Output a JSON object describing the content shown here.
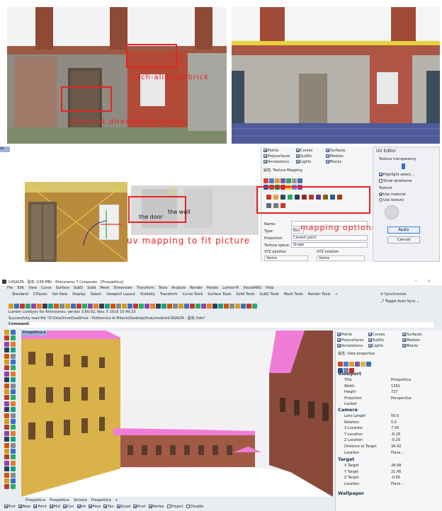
{
  "annotations_top": {
    "arch_label": "arch-aligned brick",
    "wood_label": "different direction of wood"
  },
  "annotations_mid": {
    "door_label": "the door",
    "wall_label": "the wall",
    "uv_label": "uv mapping to fit picture",
    "mapping_label": "mapping options"
  },
  "mid_panel": {
    "tab_label": "ra",
    "filters": [
      {
        "label": "Points",
        "checked": true
      },
      {
        "label": "Curves",
        "checked": true
      },
      {
        "label": "Surfaces",
        "checked": true
      },
      {
        "label": "Polysurfaces",
        "checked": true
      },
      {
        "label": "SubDs",
        "checked": true
      },
      {
        "label": "Meshes",
        "checked": true
      },
      {
        "label": "Annotations",
        "checked": true
      },
      {
        "label": "Lights",
        "checked": true
      },
      {
        "label": "Blocks",
        "checked": true
      }
    ],
    "section_title": "属性: Texture Mapping",
    "name_label": "Name:",
    "type_label": "Type:",
    "type_value": "Box",
    "projection_label": "Projection:",
    "projection_value": "Closest point",
    "texture_space_label": "Texture space:",
    "texture_space_value": "Single",
    "xyz_position_label": "XYZ position",
    "xyz_rotation_label": "XYZ rotation",
    "varies": "Varies"
  },
  "uv_editor": {
    "title": "UV Editor",
    "transparency_label": "Texture transparency",
    "highlight_label": "Highlight select...",
    "wireframe_label": "Show wireframe",
    "texture_label": "Texture",
    "use_material": "Use material",
    "use_texture": "Use texture",
    "apply": "Apply",
    "cancel": "Cancel"
  },
  "rhino": {
    "title": "CASALTA - 副本 (158 MB) - Rhinoceros 7 Corporate - [Prospettica]",
    "menu": [
      "File",
      "Edit",
      "View",
      "Curve",
      "Surface",
      "SubD",
      "Solid",
      "Mesh",
      "Dimension",
      "Transform",
      "Tools",
      "Analyze",
      "Render",
      "Panels",
      "Lumion®",
      "VisualARQ",
      "Help"
    ],
    "tabs": [
      "Standard",
      "CPlanes",
      "Set View",
      "Display",
      "Select",
      "Viewport Layout",
      "Visibility",
      "Transform",
      "Curve Tools",
      "Surface Tools",
      "Solid Tools",
      "SubD Tools",
      "Mesh Tools",
      "Render Tools"
    ],
    "tabs_more": "»",
    "sync_label": "Synchronize",
    "toggle_label": "Toggle Auto Sync",
    "cmd_history": [
      "Lumion LiveSync for Rhinoceros, version 3.60.62, Nov. 5 2019 15:49:23",
      "Successfully read file \"D:\\OneDrive\\OneDrive - Politecnico di Milano\\Desktop\\finalymodels\\CASALTA - 副本.3dm\""
    ],
    "command_label": "Command:",
    "viewport_label": "Prospettica",
    "bottom_tabs": [
      "Prospettica",
      "Prospettica",
      "Sinistra",
      "Prospettica"
    ],
    "status_snaps": [
      "End",
      "Near",
      "Point",
      "Mid",
      "Cen",
      "Int",
      "Perp",
      "Tan",
      "Quad",
      "Knot",
      "Vertex",
      "Project",
      "Disable"
    ],
    "filters": [
      {
        "label": "Points",
        "checked": true
      },
      {
        "label": "Curves",
        "checked": true
      },
      {
        "label": "Surfaces",
        "checked": true
      },
      {
        "label": "Polysurfaces",
        "checked": true
      },
      {
        "label": "SubDs",
        "checked": true
      },
      {
        "label": "Meshes",
        "checked": true
      },
      {
        "label": "Annotations",
        "checked": true
      },
      {
        "label": "Lights",
        "checked": true
      },
      {
        "label": "Blocks",
        "checked": true
      }
    ],
    "view_props_title": "属性: View properties",
    "viewport_section": "Viewport",
    "viewport_props": [
      {
        "k": "Title",
        "v": "Prospettica"
      },
      {
        "k": "Width",
        "v": "1352"
      },
      {
        "k": "Height",
        "v": "727"
      },
      {
        "k": "Projection",
        "v": "Perspective"
      },
      {
        "k": "Locked",
        "v": ""
      }
    ],
    "camera_section": "Camera",
    "camera_props": [
      {
        "k": "Lens Length",
        "v": "50.0"
      },
      {
        "k": "Rotation",
        "v": "0.0"
      },
      {
        "k": "X Location",
        "v": "7.56"
      },
      {
        "k": "Y Location",
        "v": "-6.18"
      },
      {
        "k": "Z Location",
        "v": "-0.29"
      },
      {
        "k": "Distance to Target",
        "v": "34.42"
      },
      {
        "k": "Location",
        "v": "Place..."
      }
    ],
    "target_section": "Target",
    "target_props": [
      {
        "k": "X Target",
        "v": "28.08"
      },
      {
        "k": "Y Target",
        "v": "21.45"
      },
      {
        "k": "Z Target",
        "v": "-0.65"
      },
      {
        "k": "Location",
        "v": "Place..."
      }
    ],
    "wallpaper_section": "Wallpaper"
  },
  "colors": {
    "red": "#e8231f",
    "roof_magenta": "#f07cd8",
    "facade_yellow": "#d9b24a",
    "brick": "#9a4a34",
    "rhino_bg": "#e9ecf1"
  }
}
